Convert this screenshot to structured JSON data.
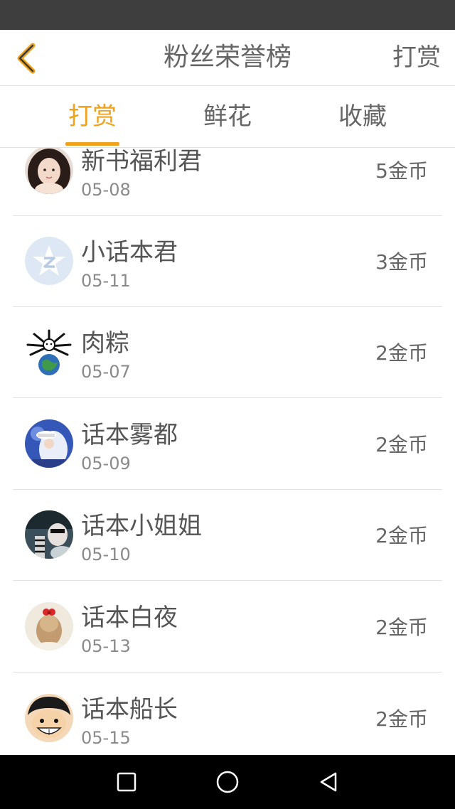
{
  "header": {
    "title": "粉丝荣誉榜",
    "action_label": "打赏"
  },
  "tabs": [
    {
      "label": "打赏",
      "active": true
    },
    {
      "label": "鲜花",
      "active": false
    },
    {
      "label": "收藏",
      "active": false
    }
  ],
  "rows": [
    {
      "name": "新书福利君",
      "date": "05-08",
      "amount": "5金币"
    },
    {
      "name": "小话本君",
      "date": "05-11",
      "amount": "3金币"
    },
    {
      "name": "肉粽",
      "date": "05-07",
      "amount": "2金币"
    },
    {
      "name": "话本雾都",
      "date": "05-09",
      "amount": "2金币"
    },
    {
      "name": "话本小姐姐",
      "date": "05-10",
      "amount": "2金币"
    },
    {
      "name": "话本白夜",
      "date": "05-13",
      "amount": "2金币"
    },
    {
      "name": "话本船长",
      "date": "05-15",
      "amount": "2金币"
    }
  ],
  "colors": {
    "accent": "#f0a21c",
    "status_bar": "#3e3e3e",
    "nav_bar": "#000000"
  },
  "icons": {
    "back": "chevron-left-icon",
    "nav_recent": "square-icon",
    "nav_home": "circle-icon",
    "nav_back": "triangle-back-icon"
  }
}
